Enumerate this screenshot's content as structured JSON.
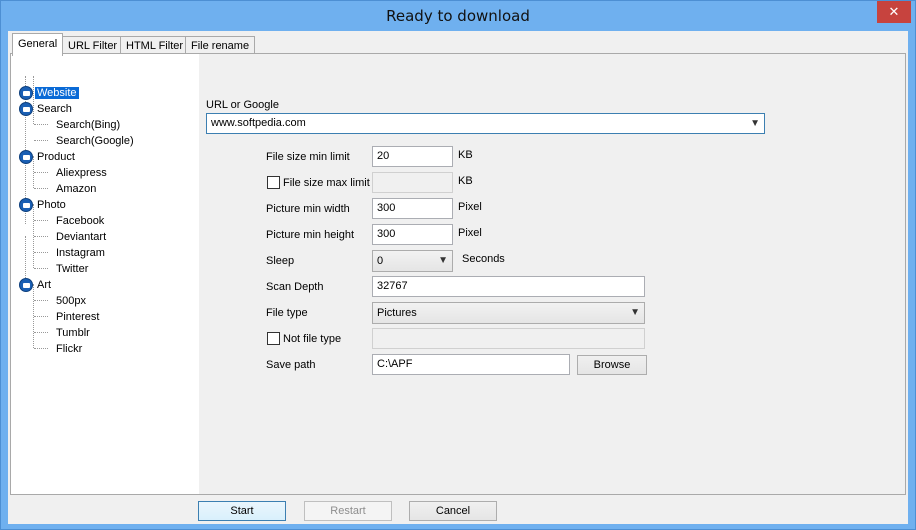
{
  "window": {
    "title": "Ready to download",
    "close_glyph": "✕"
  },
  "tabs": [
    {
      "label": "General"
    },
    {
      "label": "URL Filter"
    },
    {
      "label": "HTML Filter"
    },
    {
      "label": "File rename"
    }
  ],
  "tree": {
    "groups": [
      {
        "label": "Website",
        "selected": true
      },
      {
        "label": "Search",
        "children": [
          "Search(Bing)",
          "Search(Google)"
        ]
      },
      {
        "label": "Product",
        "children": [
          "Aliexpress",
          "Amazon"
        ]
      },
      {
        "label": "Photo",
        "children": [
          "Facebook",
          "Deviantart",
          "Instagram",
          "Twitter"
        ]
      },
      {
        "label": "Art",
        "children": [
          "500px",
          "Pinterest",
          "Tumblr",
          "Flickr"
        ]
      }
    ]
  },
  "form": {
    "url_label": "URL or Google",
    "url_value": "www.softpedia.com",
    "file_size_min_label": "File size min limit",
    "file_size_min_value": "20",
    "file_size_min_unit": "KB",
    "file_size_max_label": "File size max limit",
    "file_size_max_value": "",
    "file_size_max_unit": "KB",
    "picture_min_width_label": "Picture min width",
    "picture_min_width_value": "300",
    "picture_min_width_unit": "Pixel",
    "picture_min_height_label": "Picture min height",
    "picture_min_height_value": "300",
    "picture_min_height_unit": "Pixel",
    "sleep_label": "Sleep",
    "sleep_value": "0",
    "sleep_unit": "Seconds",
    "scan_depth_label": "Scan Depth",
    "scan_depth_value": "32767",
    "file_type_label": "File type",
    "file_type_value": "Pictures",
    "not_file_type_label": "Not file type",
    "not_file_type_value": "",
    "save_path_label": "Save path",
    "save_path_value": "C:\\APF",
    "browse_label": "Browse"
  },
  "buttons": {
    "start": "Start",
    "restart": "Restart",
    "cancel": "Cancel"
  },
  "colors": {
    "title_bar": "#6fb0ef",
    "close_button": "#c7433e",
    "selection": "#0a6ad6",
    "folder_icon": "#1a5fb4"
  }
}
